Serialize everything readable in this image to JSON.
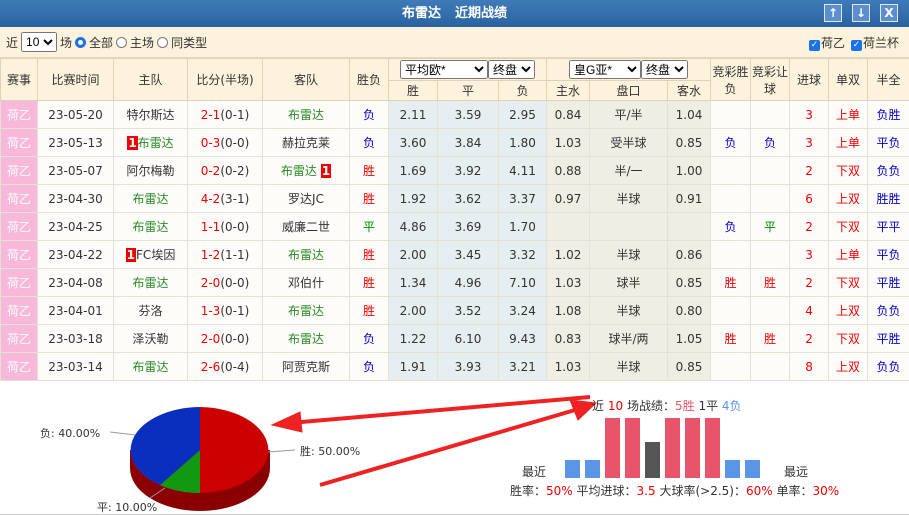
{
  "title": {
    "team": "布雷达",
    "subtitle": "近期战绩"
  },
  "window_buttons": [
    "↑",
    "↓",
    "X"
  ],
  "filter": {
    "prefix": "近",
    "count": "10",
    "suffix": "场",
    "options": [
      "全部",
      "主场",
      "同类型"
    ],
    "selected": "全部",
    "checks": [
      "荷乙",
      "荷兰杯"
    ]
  },
  "headers": {
    "league": "赛事",
    "time": "比赛时间",
    "home": "主队",
    "score": "比分(半场)",
    "away": "客队",
    "result": "胜负",
    "euro_select": "平均欧*",
    "euro_close": "终盘",
    "asia_select": "皇G亚*",
    "asia_close": "终盘",
    "jc_wl": "竞彩胜负",
    "jc_hc": "竞彩让球",
    "goals": "进球",
    "oe": "单双",
    "htft": "半全",
    "w": "胜",
    "d": "平",
    "l": "负",
    "hw": "主水",
    "line": "盘口",
    "aw": "客水"
  },
  "rows": [
    {
      "league": "荷乙",
      "date": "23-05-20",
      "home": "特尔斯达",
      "home_badge": "",
      "score": "2-1",
      "ht": "(0-1)",
      "away": "布雷达",
      "away_badge": "",
      "res": "负",
      "w": "2.11",
      "d": "3.59",
      "l": "2.95",
      "hw": "0.84",
      "line": "平/半",
      "aw": "1.04",
      "jc1": "",
      "jc2": "",
      "goals": "3",
      "oe": "上单",
      "htft": "负胜",
      "bh": false
    },
    {
      "league": "荷乙",
      "date": "23-05-13",
      "home": "布雷达",
      "home_badge": "1",
      "score": "0-3",
      "ht": "(0-0)",
      "away": "赫拉克莱",
      "away_badge": "",
      "res": "负",
      "w": "3.60",
      "d": "3.84",
      "l": "1.80",
      "hw": "1.03",
      "line": "受半球",
      "aw": "0.85",
      "jc1": "负",
      "jc2": "负",
      "goals": "3",
      "oe": "上单",
      "htft": "平负",
      "bh": true
    },
    {
      "league": "荷乙",
      "date": "23-05-07",
      "home": "阿尔梅勒",
      "home_badge": "",
      "score": "0-2",
      "ht": "(0-2)",
      "away": "布雷达",
      "away_badge": "1",
      "res": "胜",
      "w": "1.69",
      "d": "3.92",
      "l": "4.11",
      "hw": "0.88",
      "line": "半/一",
      "aw": "1.00",
      "jc1": "",
      "jc2": "",
      "goals": "2",
      "oe": "下双",
      "htft": "负负",
      "bh": false
    },
    {
      "league": "荷乙",
      "date": "23-04-30",
      "home": "布雷达",
      "home_badge": "",
      "score": "4-2",
      "ht": "(3-1)",
      "away": "罗达JC",
      "away_badge": "",
      "res": "胜",
      "w": "1.92",
      "d": "3.62",
      "l": "3.37",
      "hw": "0.97",
      "line": "半球",
      "aw": "0.91",
      "jc1": "",
      "jc2": "",
      "goals": "6",
      "oe": "上双",
      "htft": "胜胜",
      "bh": true
    },
    {
      "league": "荷乙",
      "date": "23-04-25",
      "home": "布雷达",
      "home_badge": "",
      "score": "1-1",
      "ht": "(0-0)",
      "away": "威廉二世",
      "away_badge": "",
      "res": "平",
      "w": "4.86",
      "d": "3.69",
      "l": "1.70",
      "hw": "",
      "line": "",
      "aw": "",
      "jc1": "负",
      "jc2": "平",
      "goals": "2",
      "oe": "下双",
      "htft": "平平",
      "bh": true
    },
    {
      "league": "荷乙",
      "date": "23-04-22",
      "home": "FC埃因",
      "home_badge": "1",
      "score": "1-2",
      "ht": "(1-1)",
      "away": "布雷达",
      "away_badge": "",
      "res": "胜",
      "w": "2.00",
      "d": "3.45",
      "l": "3.32",
      "hw": "1.02",
      "line": "半球",
      "aw": "0.86",
      "jc1": "",
      "jc2": "",
      "goals": "3",
      "oe": "上单",
      "htft": "平负",
      "bh": false
    },
    {
      "league": "荷乙",
      "date": "23-04-08",
      "home": "布雷达",
      "home_badge": "",
      "score": "2-0",
      "ht": "(0-0)",
      "away": "邓伯什",
      "away_badge": "",
      "res": "胜",
      "w": "1.34",
      "d": "4.96",
      "l": "7.10",
      "hw": "1.03",
      "line": "球半",
      "aw": "0.85",
      "jc1": "胜",
      "jc2": "胜",
      "goals": "2",
      "oe": "下双",
      "htft": "平胜",
      "bh": true
    },
    {
      "league": "荷乙",
      "date": "23-04-01",
      "home": "芬洛",
      "home_badge": "",
      "score": "1-3",
      "ht": "(0-1)",
      "away": "布雷达",
      "away_badge": "",
      "res": "胜",
      "w": "2.00",
      "d": "3.52",
      "l": "3.24",
      "hw": "1.08",
      "line": "半球",
      "aw": "0.80",
      "jc1": "",
      "jc2": "",
      "goals": "4",
      "oe": "上双",
      "htft": "负负",
      "bh": false
    },
    {
      "league": "荷乙",
      "date": "23-03-18",
      "home": "泽沃勒",
      "home_badge": "",
      "score": "2-0",
      "ht": "(0-0)",
      "away": "布雷达",
      "away_badge": "",
      "res": "负",
      "w": "1.22",
      "d": "6.10",
      "l": "9.43",
      "hw": "0.83",
      "line": "球半/两",
      "aw": "1.05",
      "jc1": "胜",
      "jc2": "胜",
      "goals": "2",
      "oe": "下双",
      "htft": "平胜",
      "bh": false
    },
    {
      "league": "荷乙",
      "date": "23-03-14",
      "home": "布雷达",
      "home_badge": "",
      "score": "2-6",
      "ht": "(0-4)",
      "away": "阿贾克斯",
      "away_badge": "",
      "res": "负",
      "w": "1.91",
      "d": "3.93",
      "l": "3.21",
      "hw": "1.03",
      "line": "半球",
      "aw": "0.85",
      "jc1": "",
      "jc2": "",
      "goals": "8",
      "oe": "上双",
      "htft": "负负",
      "bh": true
    }
  ],
  "pie": {
    "win": {
      "label": "胜: 50.00%",
      "value": 50,
      "color": "#cc0000"
    },
    "draw": {
      "label": "平: 10.00%",
      "value": 10,
      "color": "#119911"
    },
    "loss": {
      "label": "负: 40.00%",
      "value": 40,
      "color": "#0a2fbf"
    }
  },
  "summary": {
    "pre": "近",
    "n": "10",
    "mid": "场战绩：",
    "w": "5胜",
    "d": "1平",
    "l": "4负",
    "recent": "最近",
    "far": "最远",
    "results": [
      "负",
      "负",
      "胜",
      "胜",
      "平",
      "胜",
      "胜",
      "胜",
      "负",
      "负"
    ],
    "stats": [
      {
        "k": "胜率：",
        "v": "50%"
      },
      {
        "k": "平均进球：",
        "v": "3.5"
      },
      {
        "k": "大球率(>2.5)：",
        "v": "60%"
      },
      {
        "k": "单率：",
        "v": "30%"
      }
    ]
  },
  "colors": {
    "win": "#e8546a",
    "draw": "#555555",
    "loss": "#5b96e6"
  }
}
